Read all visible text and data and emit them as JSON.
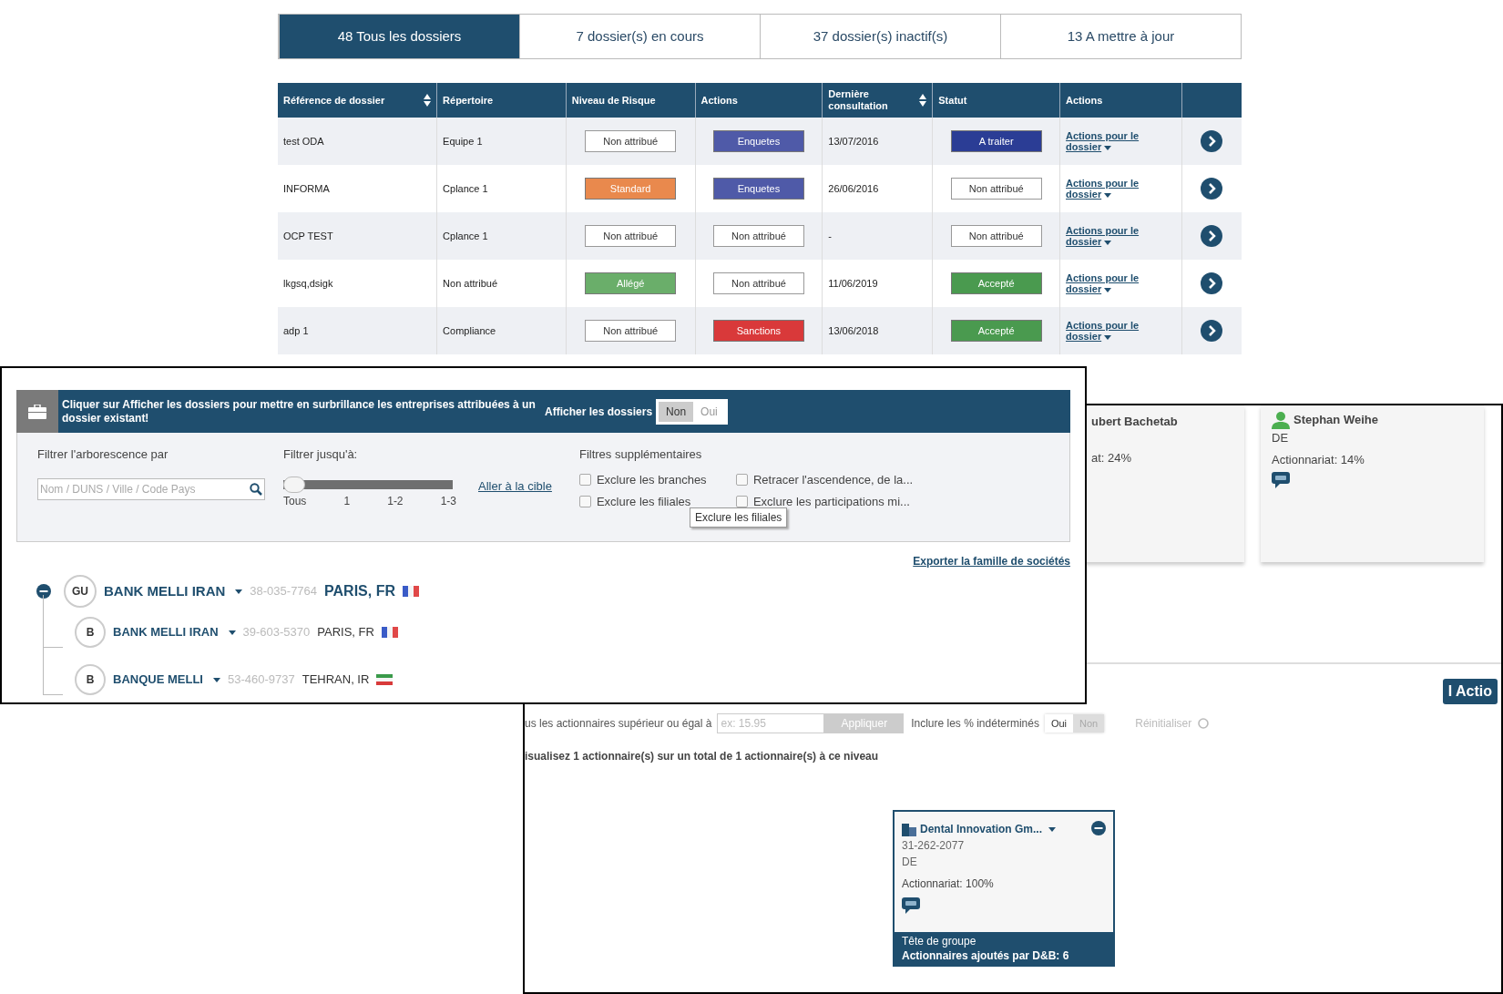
{
  "folders_window": {
    "tabs": [
      {
        "label": "48 Tous les dossiers",
        "selected": true
      },
      {
        "label": "7 dossier(s) en cours",
        "selected": false
      },
      {
        "label": "37 dossier(s) inactif(s)",
        "selected": false
      },
      {
        "label": "13 A mettre à jour",
        "selected": false
      }
    ],
    "table": {
      "columns": [
        {
          "label": "Référence de dossier",
          "sortable": true
        },
        {
          "label": "Répertoire",
          "sortable": false
        },
        {
          "label": "Niveau de Risque",
          "sortable": false
        },
        {
          "label": "Actions",
          "sortable": false
        },
        {
          "label": "Dernière consultation",
          "sortable": true
        },
        {
          "label": "Statut",
          "sortable": false
        },
        {
          "label": "Actions",
          "sortable": false
        }
      ],
      "rows": [
        {
          "reference": "test ODA",
          "directory": "Equipe 1",
          "risk": {
            "label": "Non attribué",
            "color": "#ffffff"
          },
          "action": {
            "label": "Enquetes",
            "color": "#4f5aa8"
          },
          "last_viewed": "13/07/2016",
          "status": {
            "label": "A traiter",
            "color": "#2b3d95"
          },
          "link": "Actions pour le dossier"
        },
        {
          "reference": "INFORMA",
          "directory": "Cplance 1",
          "risk": {
            "label": "Standard",
            "color": "#e9894d"
          },
          "action": {
            "label": "Enquetes",
            "color": "#4f5aa8"
          },
          "last_viewed": "26/06/2016",
          "status": {
            "label": "Non attribué",
            "color": "#ffffff"
          },
          "link": "Actions pour le dossier"
        },
        {
          "reference": "OCP TEST",
          "directory": "Cplance 1",
          "risk": {
            "label": "Non attribué",
            "color": "#ffffff"
          },
          "action": {
            "label": "Non attribué",
            "color": "#ffffff"
          },
          "last_viewed": "-",
          "status": {
            "label": "Non attribué",
            "color": "#ffffff"
          },
          "link": "Actions pour le dossier"
        },
        {
          "reference": "lkgsq,dsigk",
          "directory": "Non attribué",
          "risk": {
            "label": "Allégé",
            "color": "#6aae6a"
          },
          "action": {
            "label": "Non attribué",
            "color": "#ffffff"
          },
          "last_viewed": "11/06/2019",
          "status": {
            "label": "Accepté",
            "color": "#4a9a4f"
          },
          "link": "Actions pour le dossier"
        },
        {
          "reference": "adp 1",
          "directory": "Compliance",
          "risk": {
            "label": "Non attribué",
            "color": "#ffffff"
          },
          "action": {
            "label": "Sanctions",
            "color": "#d9393a"
          },
          "last_viewed": "13/06/2018",
          "status": {
            "label": "Accepté",
            "color": "#4a9a4f"
          },
          "link": "Actions pour le dossier"
        }
      ]
    }
  },
  "family_tree_window": {
    "banner": {
      "message": "Cliquer sur Afficher les dossiers pour mettre en surbrillance les entreprises attribuées à un dossier existant!",
      "toggle_label": "Afficher les dossiers",
      "options": [
        {
          "label": "Non",
          "selected": true
        },
        {
          "label": "Oui",
          "selected": false
        }
      ]
    },
    "filters": {
      "tree_label": "Filtrer l'arborescence par",
      "tree_placeholder": "Nom / DUNS / Ville / Code Pays",
      "depth_label": "Filtrer jusqu'à:",
      "depth": {
        "level": 0,
        "ticks": [
          "Tous",
          "1",
          "1-2",
          "1-3"
        ]
      },
      "target_link": "Aller à la cible",
      "extra_label": "Filtres supplémentaires",
      "extra": [
        {
          "label": "Exclure les branches",
          "checked": false
        },
        {
          "label": "Retracer l'ascendence, de la...",
          "checked": false
        },
        {
          "label": "Exclure les filiales",
          "checked": false
        },
        {
          "label": "Exclure les participations mi...",
          "checked": false
        }
      ],
      "tooltip": "Exclure les filiales"
    },
    "export_link": "Exporter la famille de sociétés",
    "tree": [
      {
        "badge": "GU",
        "name": "BANK MELLI IRAN",
        "duns": "38-035-7764",
        "location": "PARIS, FR",
        "kind": "fr",
        "expanded": true,
        "children": [
          {
            "badge": "B",
            "name": "BANK MELLI IRAN",
            "duns": "39-603-5370",
            "location": "PARIS, FR",
            "kind": "fr"
          },
          {
            "badge": "B",
            "name": "BANQUE MELLI",
            "duns": "53-460-9737",
            "location": "TEHRAN, IR",
            "kind": "ir"
          }
        ]
      }
    ]
  },
  "shareholders_window": {
    "top_cards": [
      {
        "name": "ubert Bachetab",
        "detail": "at: 24%"
      },
      {
        "name": "Stephan Weihe",
        "country": "DE",
        "detail": "Actionnariat: 14%"
      }
    ],
    "action_button": "I Actio",
    "threshold_label": "us les actionnaires supérieur ou égal à",
    "threshold_placeholder": "ex: 15.95",
    "apply_button": "Appliquer",
    "include_label": "Inclure les % indéterminés",
    "include_options": [
      {
        "label": "Oui",
        "selected": true
      },
      {
        "label": "Non",
        "selected": false
      }
    ],
    "reset_button": "Réinitialiser",
    "summary": "isualisez 1 actionnaire(s) sur un total de 1 actionnaire(s) à ce niveau",
    "card": {
      "name": "Dental Innovation Gm...",
      "duns": "31-262-2077",
      "country": "DE",
      "share": "Actionnariat: 100%",
      "footer_title": "Tête de groupe",
      "footer_count": "Actionnaires ajoutés par D&B: 6"
    }
  }
}
